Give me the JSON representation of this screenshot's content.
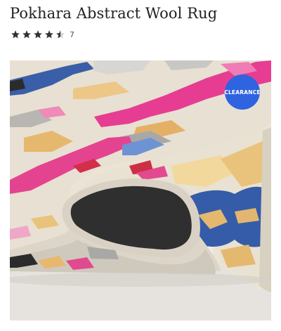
{
  "product": {
    "title": "Pokhara Abstract Wool Rug",
    "rating": {
      "stars": 4.5,
      "max_stars": 5,
      "count": "7",
      "star_color": "#333333"
    },
    "badge": {
      "label": "CLEARANCE",
      "color": "#2f63e0"
    },
    "image": {
      "icon": "rug-photo"
    }
  }
}
